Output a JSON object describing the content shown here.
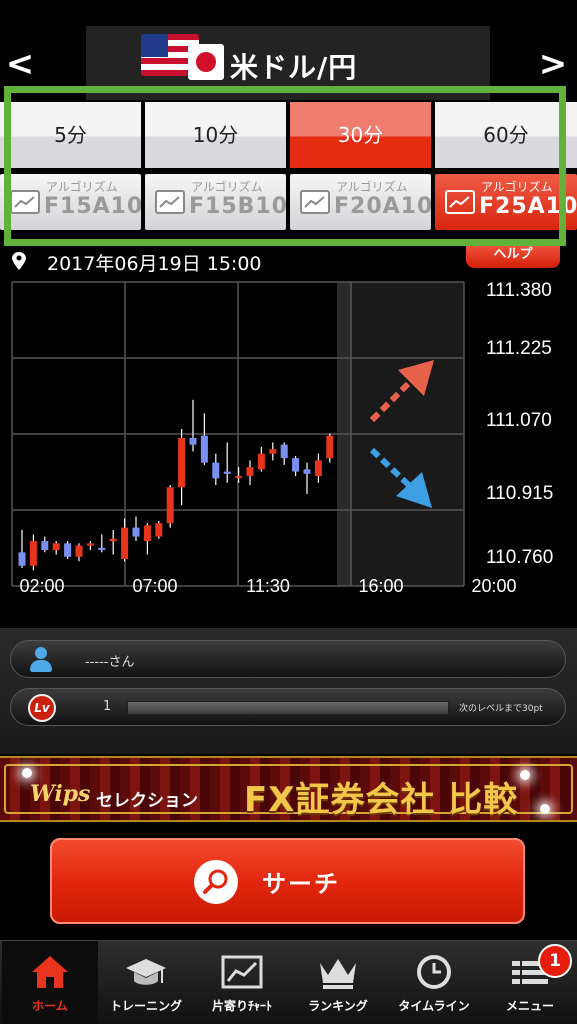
{
  "header": {
    "prev_label": "<",
    "next_label": ">",
    "pair_title": "米ドル/円"
  },
  "timeframes": [
    {
      "label": "5分",
      "active": false
    },
    {
      "label": "10分",
      "active": false
    },
    {
      "label": "30分",
      "active": true
    },
    {
      "label": "60分",
      "active": false
    }
  ],
  "algorithms": [
    {
      "sub": "アルゴリズム",
      "code": "F15A10",
      "active": false
    },
    {
      "sub": "アルゴリズム",
      "code": "F15B10",
      "active": false
    },
    {
      "sub": "アルゴリズム",
      "code": "F20A10",
      "active": false
    },
    {
      "sub": "アルゴリズム",
      "code": "F25A10",
      "active": true
    }
  ],
  "info": {
    "datetime": "2017年06月19日 15:00",
    "help_label": "ヘルプ"
  },
  "chart_data": {
    "type": "candlestick",
    "y_ticks": [
      "111.380",
      "111.225",
      "111.070",
      "110.915",
      "110.760"
    ],
    "x_ticks": [
      "02:00",
      "07:00",
      "11:30",
      "16:00",
      "20:00"
    ],
    "ylim": [
      110.76,
      111.38
    ],
    "grid": true,
    "forecast_region": "16:00-20:00",
    "forecast_arrows": [
      "up",
      "down"
    ],
    "colors": {
      "up": "#e8341c",
      "down": "#7b8ff0",
      "arrow_up": "#e8614a",
      "arrow_down": "#3d9ee3"
    },
    "candles": [
      {
        "o": 110.795,
        "h": 110.845,
        "l": 110.76,
        "c": 110.765
      },
      {
        "o": 110.765,
        "h": 110.835,
        "l": 110.755,
        "c": 110.82
      },
      {
        "o": 110.82,
        "h": 110.83,
        "l": 110.795,
        "c": 110.8
      },
      {
        "o": 110.8,
        "h": 110.82,
        "l": 110.79,
        "c": 110.815
      },
      {
        "o": 110.815,
        "h": 110.82,
        "l": 110.78,
        "c": 110.785
      },
      {
        "o": 110.785,
        "h": 110.815,
        "l": 110.775,
        "c": 110.81
      },
      {
        "o": 110.81,
        "h": 110.82,
        "l": 110.8,
        "c": 110.815
      },
      {
        "o": 110.805,
        "h": 110.835,
        "l": 110.795,
        "c": 110.8
      },
      {
        "o": 110.82,
        "h": 110.845,
        "l": 110.79,
        "c": 110.825
      },
      {
        "o": 110.78,
        "h": 110.87,
        "l": 110.775,
        "c": 110.85
      },
      {
        "o": 110.85,
        "h": 110.875,
        "l": 110.82,
        "c": 110.83
      },
      {
        "o": 110.82,
        "h": 110.86,
        "l": 110.79,
        "c": 110.855
      },
      {
        "o": 110.83,
        "h": 110.865,
        "l": 110.825,
        "c": 110.86
      },
      {
        "o": 110.86,
        "h": 110.945,
        "l": 110.85,
        "c": 110.94
      },
      {
        "o": 110.94,
        "h": 111.07,
        "l": 110.9,
        "c": 111.05
      },
      {
        "o": 111.05,
        "h": 111.135,
        "l": 111.02,
        "c": 111.035
      },
      {
        "o": 111.055,
        "h": 111.105,
        "l": 110.99,
        "c": 110.995
      },
      {
        "o": 110.995,
        "h": 111.015,
        "l": 110.945,
        "c": 110.96
      },
      {
        "o": 110.975,
        "h": 111.04,
        "l": 110.95,
        "c": 110.97
      },
      {
        "o": 110.965,
        "h": 110.985,
        "l": 110.95,
        "c": 110.965
      },
      {
        "o": 110.965,
        "h": 111.0,
        "l": 110.945,
        "c": 110.985
      },
      {
        "o": 110.98,
        "h": 111.03,
        "l": 110.975,
        "c": 111.015
      },
      {
        "o": 111.015,
        "h": 111.04,
        "l": 111.0,
        "c": 111.025
      },
      {
        "o": 111.035,
        "h": 111.04,
        "l": 110.99,
        "c": 111.005
      },
      {
        "o": 111.005,
        "h": 111.01,
        "l": 110.965,
        "c": 110.975
      },
      {
        "o": 110.98,
        "h": 110.995,
        "l": 110.925,
        "c": 110.97
      },
      {
        "o": 110.965,
        "h": 111.015,
        "l": 110.95,
        "c": 111.0
      },
      {
        "o": 111.005,
        "h": 111.06,
        "l": 110.995,
        "c": 111.055
      }
    ]
  },
  "user": {
    "name": "-----さん",
    "level_badge": "Lv",
    "level": "1",
    "progress": 0.0,
    "next_level_text": "次のレベルまで30pt"
  },
  "banner": {
    "logo": "Wips",
    "sub": "セレクション",
    "title": "FX証券会社 比較"
  },
  "search": {
    "label": "サーチ"
  },
  "nav": {
    "items": [
      {
        "label": "ホーム",
        "icon": "home-icon",
        "active": true
      },
      {
        "label": "トレーニング",
        "icon": "graduation-cap-icon",
        "active": false
      },
      {
        "label": "片寄りﾁｬｰﾄ",
        "icon": "chart-icon",
        "active": false
      },
      {
        "label": "ランキング",
        "icon": "crown-icon",
        "active": false
      },
      {
        "label": "タイムライン",
        "icon": "clock-icon",
        "active": false
      },
      {
        "label": "メニュー",
        "icon": "menu-icon",
        "active": false
      }
    ],
    "menu_badge": "1"
  }
}
